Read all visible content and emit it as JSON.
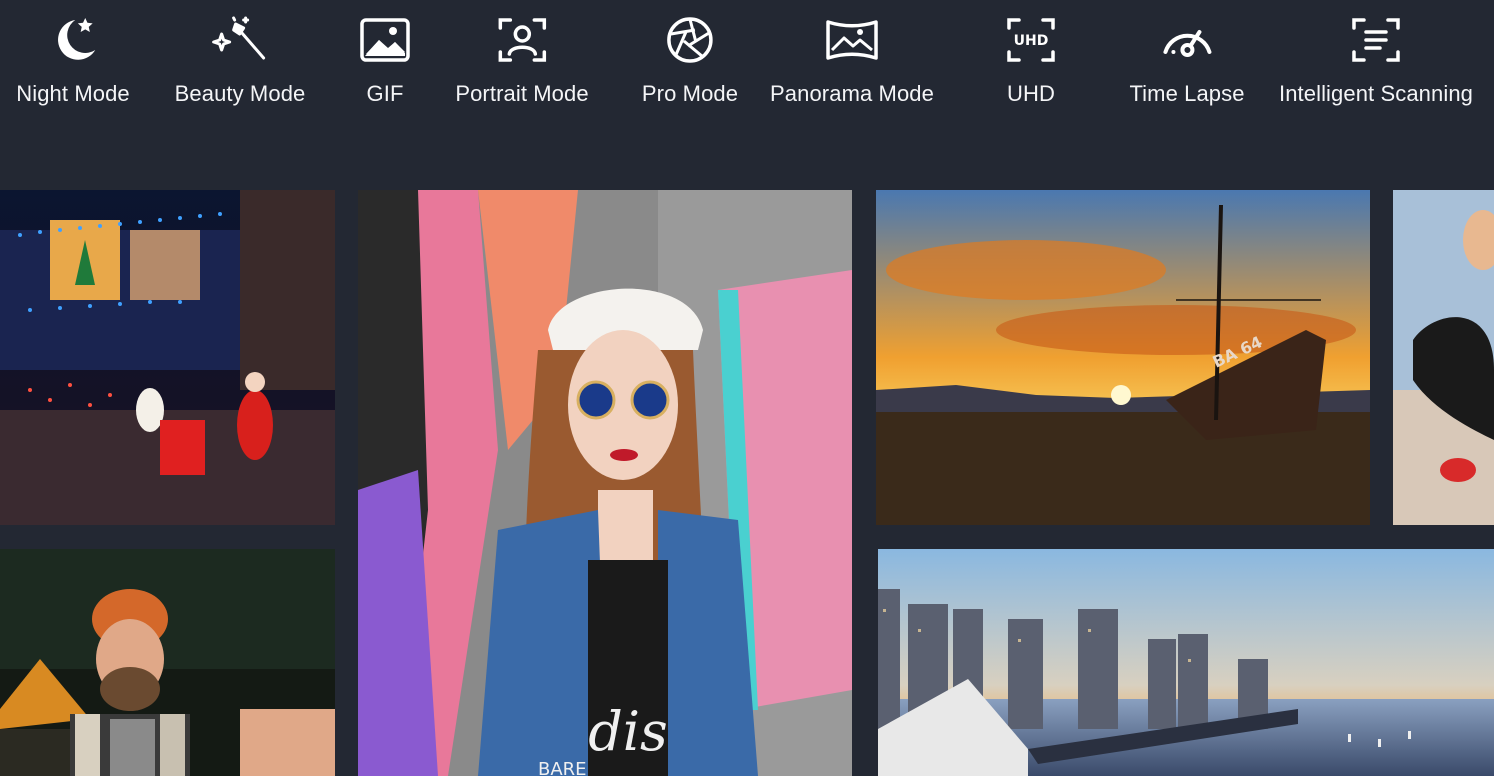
{
  "modes": [
    {
      "label": "Night Mode",
      "icon": "moon-star-icon"
    },
    {
      "label": "Beauty Mode",
      "icon": "magic-wand-sparkle-icon"
    },
    {
      "label": "GIF",
      "icon": "image-icon"
    },
    {
      "label": "Portrait Mode",
      "icon": "portrait-frame-icon"
    },
    {
      "label": "Pro Mode",
      "icon": "aperture-icon"
    },
    {
      "label": "Panorama Mode",
      "icon": "panorama-icon"
    },
    {
      "label": "UHD",
      "icon": "uhd-frame-icon"
    },
    {
      "label": "Time Lapse",
      "icon": "speedometer-icon"
    },
    {
      "label": "Intelligent Scanning",
      "icon": "scan-document-icon"
    }
  ],
  "gallery": {
    "boat_hull_text": "BA 64",
    "shirt_text_1": "dis",
    "shirt_text_2": "BARE"
  },
  "colors": {
    "background": "#232833",
    "icon": "#ffffff"
  }
}
